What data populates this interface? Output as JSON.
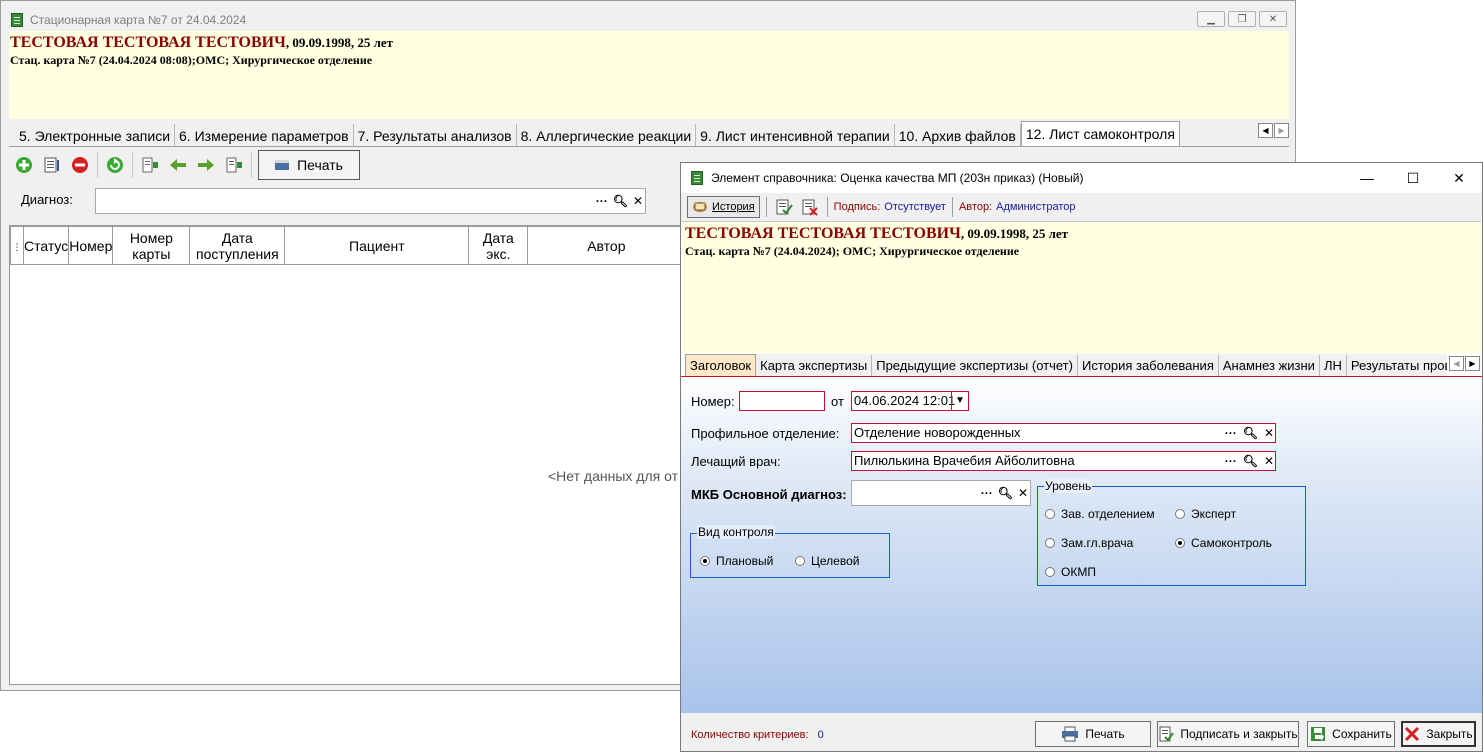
{
  "main_window": {
    "title": "Стационарная карта №7 от 24.04.2024",
    "patient": {
      "name": "ТЕСТОВАЯ ТЕСТОВАЯ ТЕСТОВИЧ",
      "dob_age": ", 09.09.1998, 25 лет",
      "card_info": "Стац. карта №7 (24.04.2024 08:08);ОМС; Хирургическое отделение"
    },
    "tabs": [
      "5. Электронные записи",
      "6. Измерение параметров",
      "7. Результаты анализов",
      "8. Аллергические реакции",
      "9. Лист интенсивной терапии",
      "10. Архив файлов",
      "12. Лист самоконтроля"
    ],
    "toolbar": {
      "print_label": "Печать"
    },
    "diagnosis_label": "Диагноз:",
    "grid_columns": [
      "Статус",
      "Номер",
      "Номер карты",
      "Дата поступления",
      "Пациент",
      "Дата экс.",
      "Автор"
    ],
    "empty_text": "<Нет данных для от"
  },
  "dialog": {
    "title": "Элемент справочника: Оценка качества МП (203н приказ) (Новый)",
    "toolbar": {
      "history_label": "История",
      "signature_label": "Подпись:",
      "signature_value": "Отсутствует",
      "author_label": "Автор:",
      "author_value": "Администратор"
    },
    "patient": {
      "name": "ТЕСТОВАЯ ТЕСТОВАЯ ТЕСТОВИЧ",
      "dob_age": ", 09.09.1998, 25 лет",
      "card_info": "Стац. карта №7 (24.04.2024); ОМС; Хирургическое отделение"
    },
    "tabs": [
      "Заголовок",
      "Карта экспертизы",
      "Предыдущие экспертизы (отчет)",
      "История заболевания",
      "Анамнез жизни",
      "ЛН",
      "Результаты проведе"
    ],
    "form": {
      "number_label": "Номер:",
      "number_value": "",
      "from_label": "от",
      "date_value": "04.06.2024 12:01",
      "department_label": "Профильное отделение:",
      "department_value": "Отделение новорожденных",
      "doctor_label": "Лечащий врач:",
      "doctor_value": "Пилюлькина Врачебия Айболитовна",
      "mkb_label": "МКБ Основной диагноз:",
      "mkb_value": "",
      "control_type": {
        "title": "Вид контроля",
        "options": [
          "Плановый",
          "Целевой"
        ],
        "selected": "Плановый"
      },
      "level": {
        "title": "Уровень",
        "options": [
          "Зав. отделением",
          "Эксперт",
          "Зам.гл.врача",
          "Самоконтроль",
          "ОКМП"
        ],
        "selected": "Самоконтроль"
      }
    },
    "status": {
      "criteria_label": "Количество критериев:",
      "criteria_count": "0"
    },
    "buttons": {
      "print": "Печать",
      "sign_close": "Подписать и закрыть",
      "save": "Сохранить",
      "close": "Закрыть"
    }
  }
}
